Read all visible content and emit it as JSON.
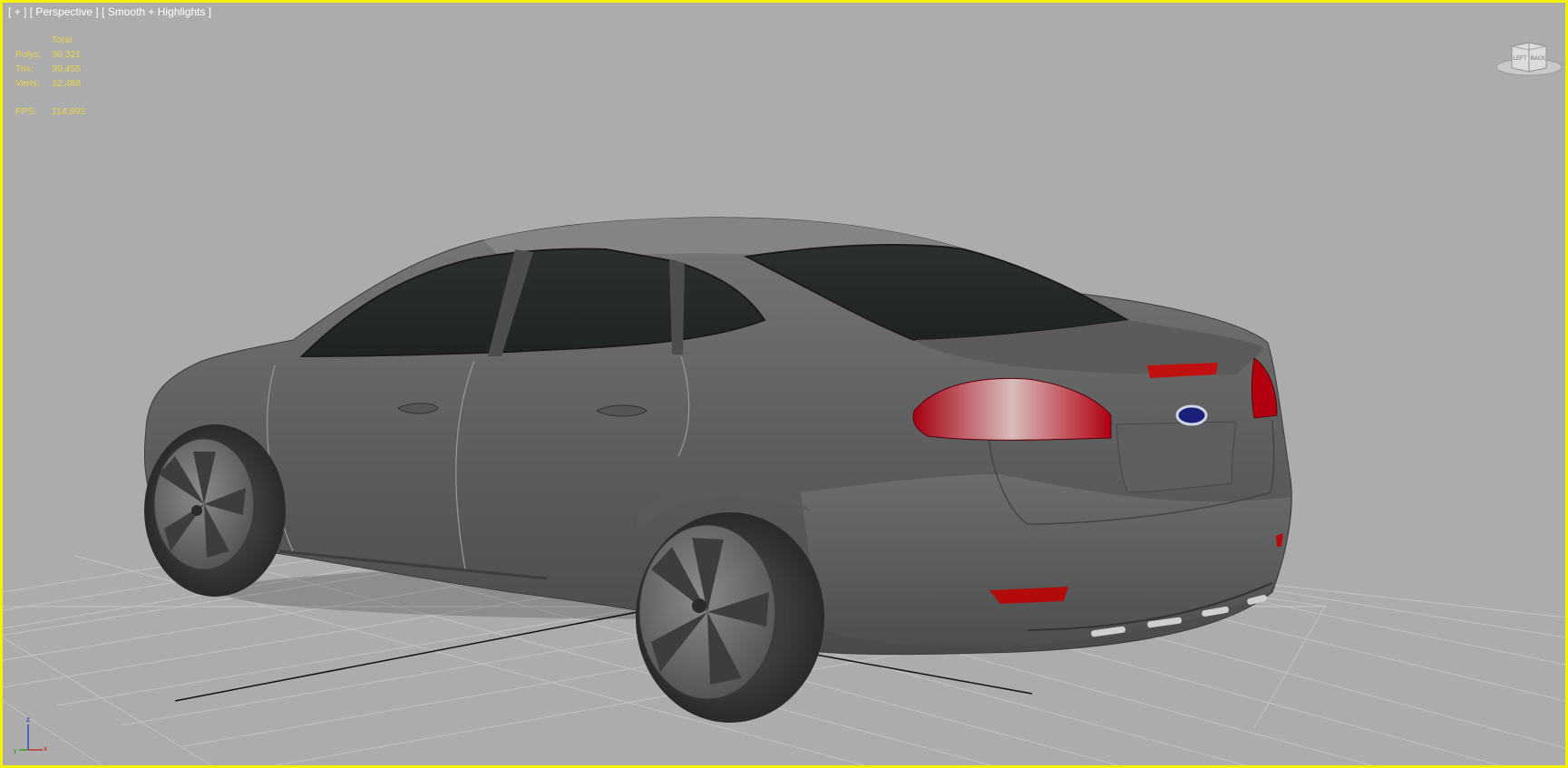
{
  "viewport": {
    "label_parts": [
      "[ + ]",
      "[ Perspective ]",
      "[ Smooth + Highlights ]"
    ],
    "border_color": "#f2f200",
    "background_color": "#acacac"
  },
  "stats": {
    "header": "Total",
    "rows": [
      {
        "label": "Polys:",
        "value": "30,321"
      },
      {
        "label": "Tris:",
        "value": "39,455"
      },
      {
        "label": "Verts:",
        "value": "32,488"
      }
    ],
    "fps_label": "FPS:",
    "fps_value": "114,895",
    "text_color": "#e8d64a"
  },
  "viewcube": {
    "left_face": "LEFT",
    "back_face": "BACK"
  },
  "axis_tripod": {
    "z_label": "z",
    "x_label": "x",
    "y_label": "y"
  },
  "icons": [
    "viewcube-icon",
    "axis-tripod-icon"
  ]
}
